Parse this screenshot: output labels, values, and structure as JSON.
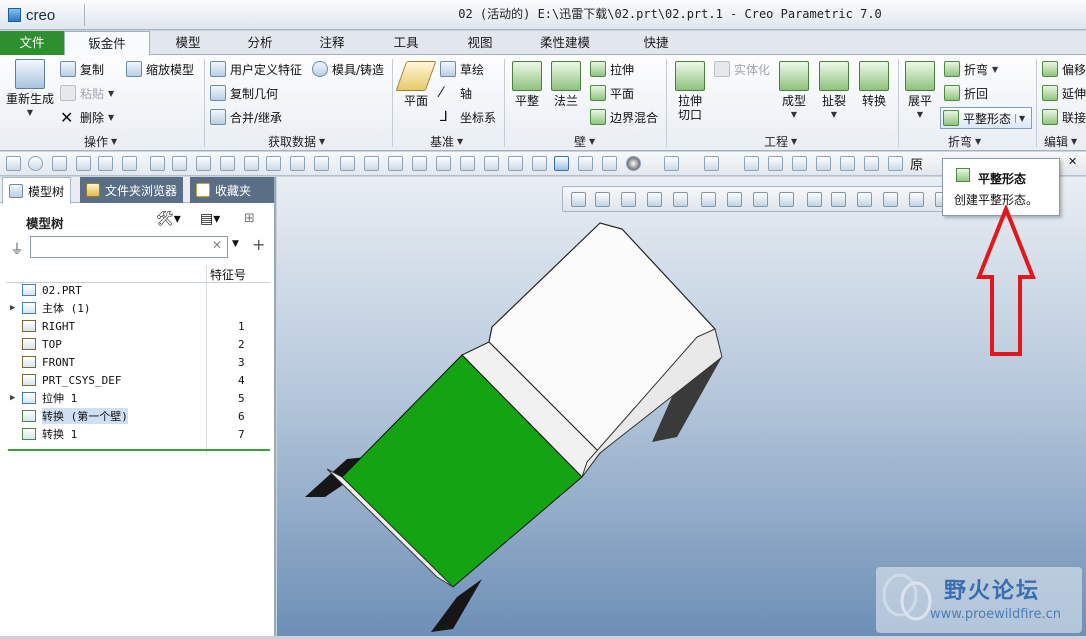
{
  "app": {
    "logo_text": "creo",
    "window_title": "02 (活动的) E:\\迅雷下载\\02.prt\\02.prt.1 - Creo Parametric 7.0"
  },
  "tabs": [
    "文件",
    "钣金件",
    "模型",
    "分析",
    "注释",
    "工具",
    "视图",
    "柔性建模",
    "快捷"
  ],
  "ribbon": {
    "operations": {
      "regen": "重新生成",
      "copy": "复制",
      "paste": "粘贴",
      "delete": "删除",
      "scale": "缩放模型",
      "group": "操作"
    },
    "getdata": {
      "udf": "用户定义特征",
      "copygeom": "复制几何",
      "merge": "合并/继承",
      "mold": "模具/铸造",
      "group": "获取数据"
    },
    "datum": {
      "plane": "平面",
      "sketch": "草绘",
      "axis": "轴",
      "csys": "坐标系",
      "group": "基准"
    },
    "wall": {
      "flat": "平整",
      "flange": "法兰",
      "extrude": "拉伸",
      "plane": "平面",
      "boundary": "边界混合",
      "solidify": "实体化",
      "group": "壁"
    },
    "engineering": {
      "extrudecut": "拉伸\n切口",
      "form": "成型",
      "rip": "扯裂",
      "convert": "转换",
      "group": "工程"
    },
    "bend": {
      "unbend": "展平",
      "bend": "折弯",
      "bendback": "折回",
      "flatstate": "平整形态",
      "group": "折弯"
    },
    "edit": {
      "offset": "偏移",
      "extend": "延伸",
      "join": "联接",
      "group": "编辑"
    }
  },
  "panel": {
    "tabs": [
      "模型树",
      "文件夹浏览器",
      "收藏夹"
    ],
    "title": "模型树",
    "search_value": "",
    "column": "特征号",
    "rows": [
      {
        "label": "02.PRT",
        "num": "",
        "expand": ""
      },
      {
        "label": "主体 (1)",
        "num": "",
        "expand": "▶"
      },
      {
        "label": "RIGHT",
        "num": "1",
        "expand": ""
      },
      {
        "label": "TOP",
        "num": "2",
        "expand": ""
      },
      {
        "label": "FRONT",
        "num": "3",
        "expand": ""
      },
      {
        "label": "PRT_CSYS_DEF",
        "num": "4",
        "expand": ""
      },
      {
        "label": "拉伸 1",
        "num": "5",
        "expand": "▶"
      },
      {
        "label": "转换 (第一个壁)",
        "num": "6",
        "expand": ""
      },
      {
        "label": "转换 1",
        "num": "7",
        "expand": ""
      }
    ]
  },
  "tooltip": {
    "title": "平整形态",
    "desc": "创建平整形态。"
  },
  "watermark": {
    "title": "野火论坛",
    "url": "www.proewildfire.cn"
  },
  "colors": {
    "file_tab": "#2e8f2e",
    "highlight_face": "#13a313",
    "arrow": "#e3171b"
  }
}
